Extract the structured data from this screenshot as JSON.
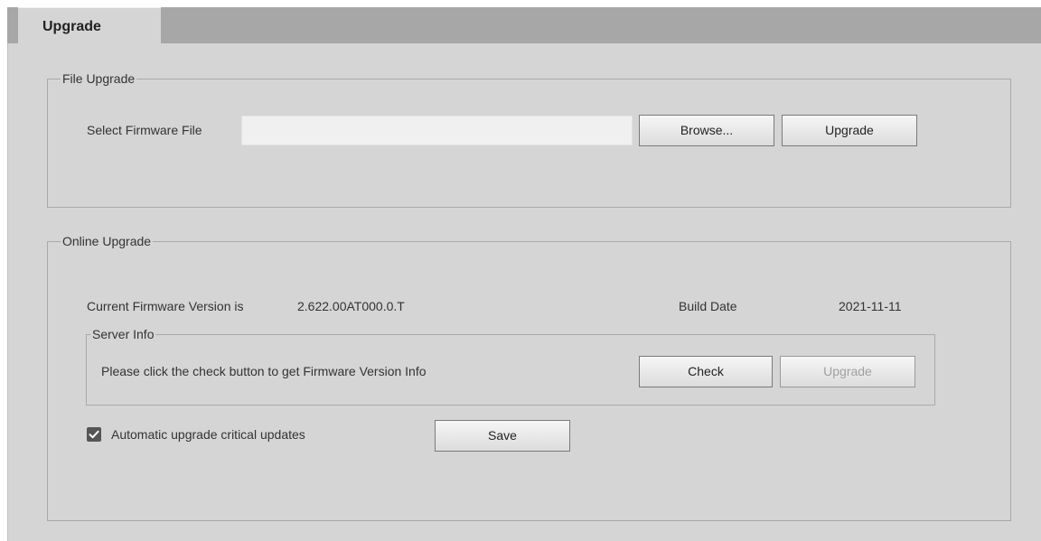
{
  "tab": {
    "label": "Upgrade"
  },
  "file_upgrade": {
    "legend": "File Upgrade",
    "select_label": "Select Firmware File",
    "file_value": "",
    "browse_label": "Browse...",
    "upgrade_label": "Upgrade"
  },
  "online_upgrade": {
    "legend": "Online Upgrade",
    "current_version_label": "Current Firmware Version is",
    "current_version_value": "2.622.00AT000.0.T",
    "build_date_label": "Build Date",
    "build_date_value": "2021-11-11",
    "server_info": {
      "legend": "Server Info",
      "message": "Please click the check button to get Firmware Version Info",
      "check_label": "Check",
      "upgrade_label": "Upgrade",
      "upgrade_disabled": true
    },
    "auto_upgrade": {
      "label": "Automatic upgrade critical updates",
      "checked": true
    },
    "save_label": "Save"
  },
  "colors": {
    "background": "#d5d5d5",
    "tab_bar": "#a7a7a7",
    "checkbox": "#555555"
  }
}
